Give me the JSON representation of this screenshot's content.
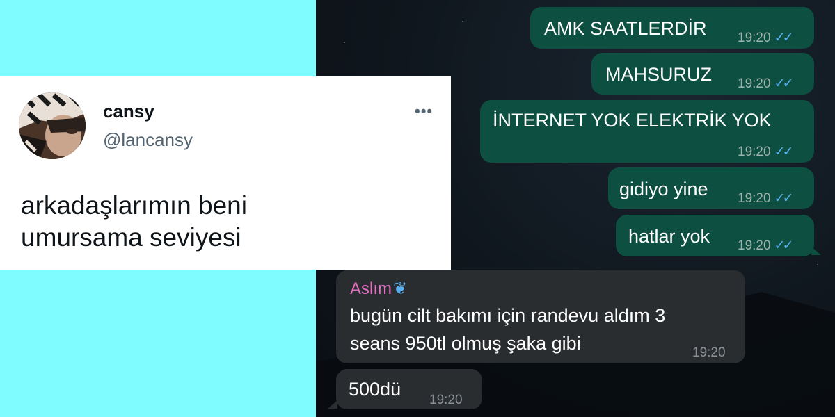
{
  "tweet": {
    "display_name": "cansy",
    "handle": "@lancansy",
    "more_label": "•••",
    "text_line1": "arkadaşlarımın beni",
    "text_line2": "umursama seviyesi"
  },
  "chat": {
    "outgoing": [
      {
        "text": "AMK  SAATLERDİR",
        "time": "19:20"
      },
      {
        "text": "MAHSURUZ",
        "time": "19:20"
      },
      {
        "text": "İNTERNET YOK ELEKTRİK YOK",
        "time": "19:20"
      },
      {
        "text": "gidiyo yine",
        "time": "19:20"
      },
      {
        "text": "hatlar yok",
        "time": "19:20"
      }
    ],
    "incoming": [
      {
        "sender": "Aslım",
        "sender_icon": "butterfly-icon",
        "line1": "bugün cilt bakımı için randevu aldım 3",
        "line2": "seans 950tl olmuş şaka gibi",
        "time": "19:20"
      },
      {
        "text": "500dü",
        "time": "19:20"
      }
    ],
    "read_ticks": "✓✓"
  },
  "colors": {
    "left_background": "#7ffcff",
    "outgoing_bubble": "#0d4f40",
    "incoming_bubble": "#2a2d30",
    "read_ticks": "#5ab0f0",
    "sender_name": "#e36fc0"
  }
}
